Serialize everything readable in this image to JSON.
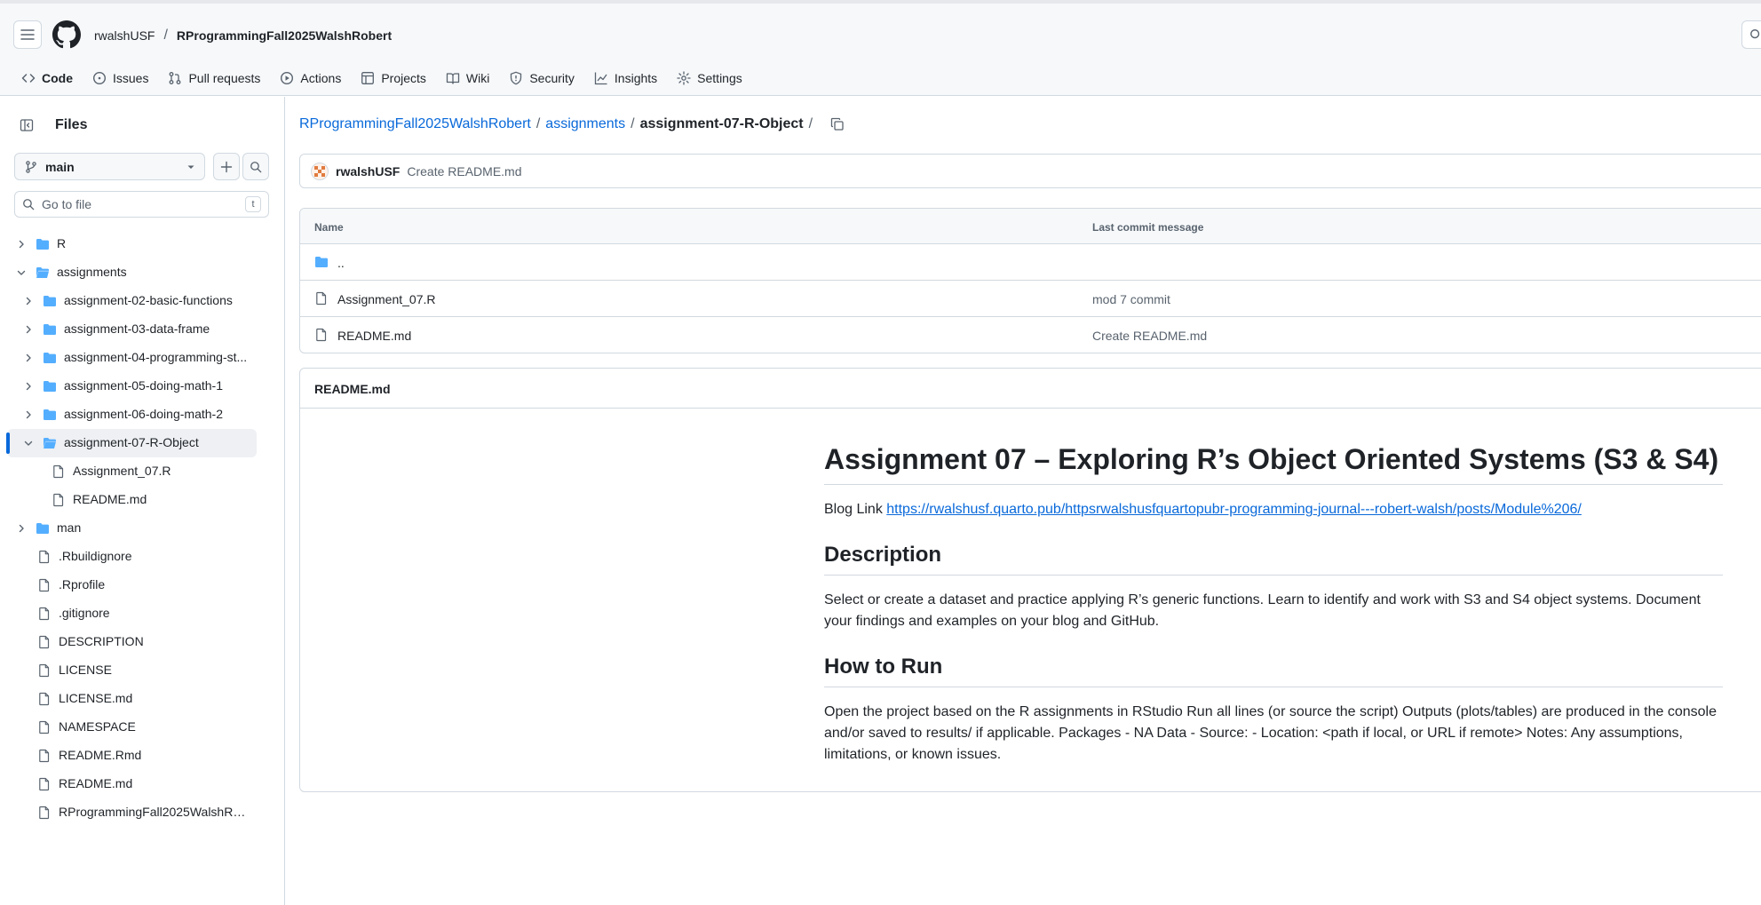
{
  "header": {
    "owner": "rwalshUSF",
    "separator": "/",
    "repo": "RProgrammingFall2025WalshRobert"
  },
  "tabs": [
    {
      "label": "Code",
      "icon": "code-icon"
    },
    {
      "label": "Issues",
      "icon": "issue-icon"
    },
    {
      "label": "Pull requests",
      "icon": "pull-request-icon"
    },
    {
      "label": "Actions",
      "icon": "play-icon"
    },
    {
      "label": "Projects",
      "icon": "table-icon"
    },
    {
      "label": "Wiki",
      "icon": "book-icon"
    },
    {
      "label": "Security",
      "icon": "shield-icon"
    },
    {
      "label": "Insights",
      "icon": "graph-icon"
    },
    {
      "label": "Settings",
      "icon": "gear-icon"
    }
  ],
  "sidebar": {
    "title": "Files",
    "branch": "main",
    "goto_placeholder": "Go to file",
    "goto_shortcut": "t",
    "tree": [
      {
        "label": "R",
        "type": "folder"
      },
      {
        "label": "assignments",
        "type": "folder-open"
      },
      {
        "label": "assignment-02-basic-functions",
        "type": "folder"
      },
      {
        "label": "assignment-03-data-frame",
        "type": "folder"
      },
      {
        "label": "assignment-04-programming-st...",
        "type": "folder"
      },
      {
        "label": "assignment-05-doing-math-1",
        "type": "folder"
      },
      {
        "label": "assignment-06-doing-math-2",
        "type": "folder"
      },
      {
        "label": "assignment-07-R-Object",
        "type": "folder-open"
      },
      {
        "label": "Assignment_07.R",
        "type": "file"
      },
      {
        "label": "README.md",
        "type": "file"
      },
      {
        "label": "man",
        "type": "folder"
      },
      {
        "label": ".Rbuildignore",
        "type": "file"
      },
      {
        "label": ".Rprofile",
        "type": "file"
      },
      {
        "label": ".gitignore",
        "type": "file"
      },
      {
        "label": "DESCRIPTION",
        "type": "file"
      },
      {
        "label": "LICENSE",
        "type": "file"
      },
      {
        "label": "LICENSE.md",
        "type": "file"
      },
      {
        "label": "NAMESPACE",
        "type": "file"
      },
      {
        "label": "README.Rmd",
        "type": "file"
      },
      {
        "label": "README.md",
        "type": "file"
      },
      {
        "label": "RProgrammingFall2025WalshRob...",
        "type": "file"
      }
    ]
  },
  "path": {
    "repo": "RProgrammingFall2025WalshRobert",
    "sep": "/",
    "folder": "assignments",
    "current": "assignment-07-R-Object"
  },
  "commit": {
    "user": "rwalshUSF",
    "message": "Create README.md"
  },
  "file_table": {
    "col_name": "Name",
    "col_message": "Last commit message",
    "parent": "..",
    "rows": [
      {
        "name": "Assignment_07.R",
        "message": "mod 7 commit"
      },
      {
        "name": "README.md",
        "message": "Create README.md"
      }
    ]
  },
  "readme": {
    "file": "README.md",
    "h1": "Assignment 07 – Exploring R’s Object Oriented Systems (S3 & S4)",
    "blog_prefix": "Blog Link ",
    "blog_url": "https://rwalshusf.quarto.pub/httpsrwalshusfquartopubr-programming-journal---robert-walsh/posts/Module%206/",
    "h2_description": "Description",
    "description": "Select or create a dataset and practice applying R’s generic functions. Learn to identify and work with S3 and S4 object systems. Document your findings and examples on your blog and GitHub.",
    "h2_run": "How to Run",
    "run_text": "Open the project based on the R assignments in RStudio Run all lines (or source the script) Outputs (plots/tables) are produced in the console and/or saved to results/ if applicable. Packages - NA Data - Source: - Location: <path if local, or URL if remote> Notes: Any assumptions, limitations, or known issues."
  },
  "colors": {
    "accent": "#0969da",
    "folder": "#54aeff",
    "tab_underline": "#fd8c73"
  }
}
